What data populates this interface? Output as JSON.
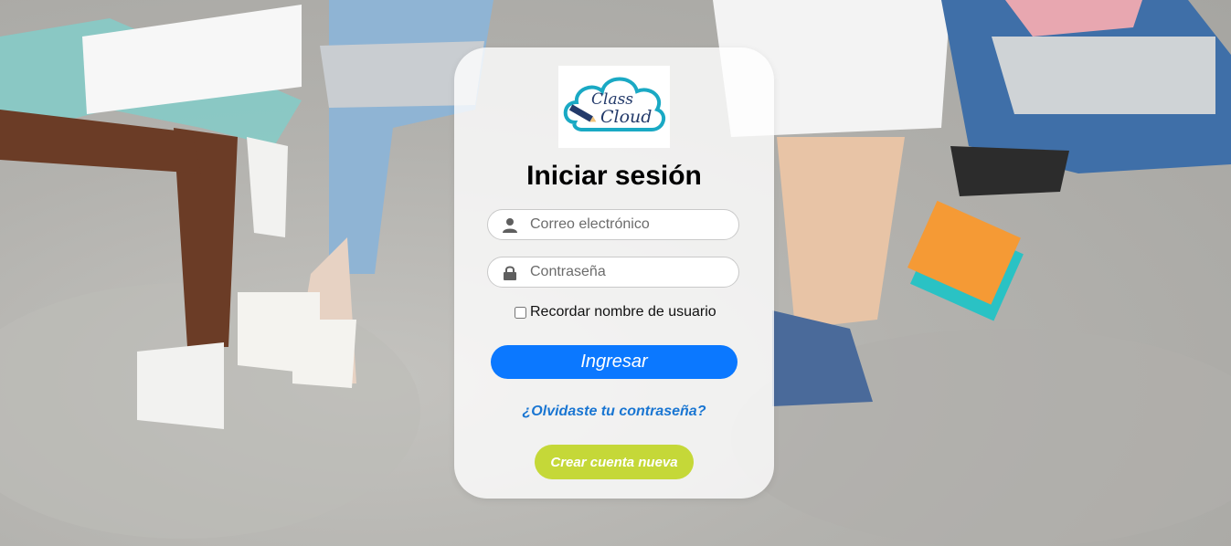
{
  "logo": {
    "line1": "Class",
    "line2": "Cloud",
    "icon": "cloud-pencil-logo",
    "color": "#1aa9c4"
  },
  "login": {
    "title": "Iniciar sesión",
    "email_placeholder": "Correo electrónico",
    "email_icon": "user-icon",
    "password_placeholder": "Contraseña",
    "password_icon": "lock-icon",
    "remember_label": "Recordar nombre de usuario",
    "remember_checked": false,
    "submit_label": "Ingresar",
    "forgot_label": "¿Olvidaste tu contraseña?",
    "create_label": "Crear cuenta nueva"
  },
  "colors": {
    "primary": "#0b78ff",
    "link": "#1a76d2",
    "create": "#c5d838",
    "card": "#ffffff"
  }
}
